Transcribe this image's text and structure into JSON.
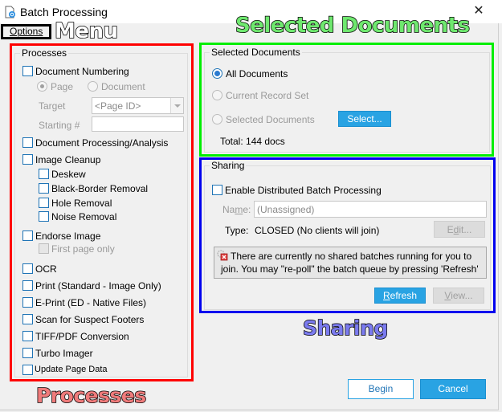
{
  "window": {
    "title": "Batch Processing",
    "close_glyph": "✕"
  },
  "menu": {
    "options_label": "Options"
  },
  "annotations": {
    "menu": "Menu",
    "selected_documents": "Selected Documents",
    "sharing": "Sharing",
    "processes": "Processes"
  },
  "highlight_colors": {
    "processes": "#ff0000",
    "selected_documents": "#00ee00",
    "sharing": "#0000ee",
    "menu": "#000000"
  },
  "processes": {
    "legend": "Processes",
    "document_numbering": {
      "label": "Document Numbering",
      "checked": false,
      "radio_page": "Page",
      "radio_document": "Document",
      "selected_radio": "Page",
      "target_label": "Target",
      "target_value": "<Page ID>",
      "starting_label": "Starting #",
      "starting_value": ""
    },
    "document_processing": {
      "label": "Document Processing/Analysis",
      "checked": false
    },
    "image_cleanup": {
      "label": "Image Cleanup",
      "checked": false,
      "sub": [
        {
          "label": "Deskew",
          "checked": false
        },
        {
          "label": "Black-Border Removal",
          "checked": false
        },
        {
          "label": "Hole Removal",
          "checked": false
        },
        {
          "label": "Noise Removal",
          "checked": false
        }
      ]
    },
    "endorse_image": {
      "label": "Endorse Image",
      "checked": false,
      "first_page_only": "First page only"
    },
    "items": [
      {
        "label": "OCR",
        "checked": false
      },
      {
        "label": "Print  (Standard - Image Only)",
        "checked": false
      },
      {
        "label": "E-Print (ED - Native Files)",
        "checked": false
      },
      {
        "label": "Scan for Suspect Footers",
        "checked": false
      },
      {
        "label": "TIFF/PDF Conversion",
        "checked": false
      },
      {
        "label": "Turbo Imager",
        "checked": false
      },
      {
        "label": "Update Page Data",
        "checked": false
      }
    ]
  },
  "selected_documents": {
    "legend": "Selected Documents",
    "options": [
      "All Documents",
      "Current Record Set",
      "Selected Documents"
    ],
    "selected": "All Documents",
    "select_button": "Select...",
    "total": "Total:  144 docs"
  },
  "sharing": {
    "legend": "Sharing",
    "enable_label": "Enable Distributed Batch Processing",
    "enable_checked": false,
    "name_label_pre": "Na",
    "name_label_ul": "m",
    "name_label_post": "e:",
    "name_value": "(Unassigned)",
    "type_label": "Type:",
    "type_value": "CLOSED (No clients will join)",
    "edit_pre": "E",
    "edit_ul": "d",
    "edit_post": "it...",
    "info_line1": "There are currently no shared batches running for you to",
    "info_line2": "join.  You may \"re-poll\" the batch queue by pressing 'Refresh'",
    "refresh_ul": "R",
    "refresh_post": "efresh",
    "view_ul": "V",
    "view_post": "iew..."
  },
  "footer": {
    "begin": "Begin",
    "cancel": "Cancel"
  }
}
